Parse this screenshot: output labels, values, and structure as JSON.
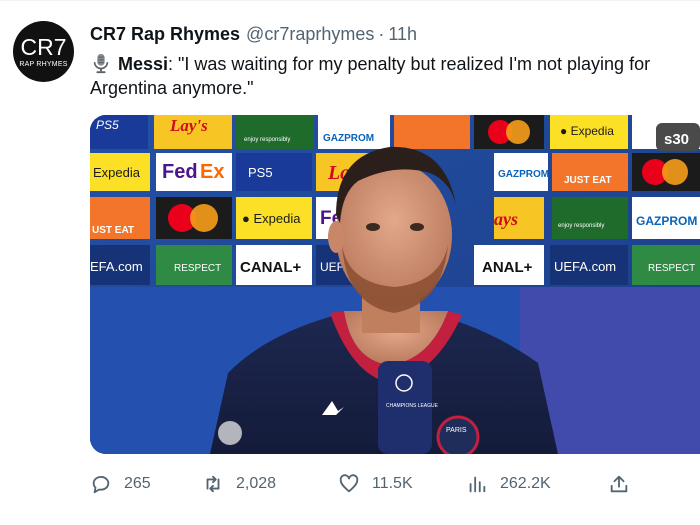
{
  "account": {
    "avatar_text": "CR7",
    "avatar_subtext": "RAP RHYMES",
    "display_name": "CR7 Rap Rhymes",
    "handle": "@cr7raprhymes",
    "separator": "·",
    "time": "11h"
  },
  "tweet": {
    "speaker": "Messi",
    "quote_line1": ": \"I was waiting for my penalty but realized I'm not playing for",
    "quote_line2": "Argentina anymore.\""
  },
  "media": {
    "sponsor_boards": [
      "Expedia",
      "FedEx",
      "Lay's",
      "Gazprom",
      "Just Eat",
      "CANAL+",
      "UEFA.com",
      "RESPECT",
      "enjoy responsibly"
    ],
    "corner_badge": "s30",
    "mic_label": "CHAMPIONS LEAGUE"
  },
  "actions": {
    "replies": "265",
    "retweets": "2,028",
    "likes": "11.5K",
    "views": "262.2K"
  },
  "icons": {
    "reply": "reply-icon",
    "retweet": "retweet-icon",
    "like": "heart-icon",
    "views": "views-icon",
    "share": "share-icon",
    "mic": "microphone-icon"
  },
  "colors": {
    "text": "#0f1419",
    "muted": "#536471",
    "backdrop_blue": "#1f3a8a"
  }
}
